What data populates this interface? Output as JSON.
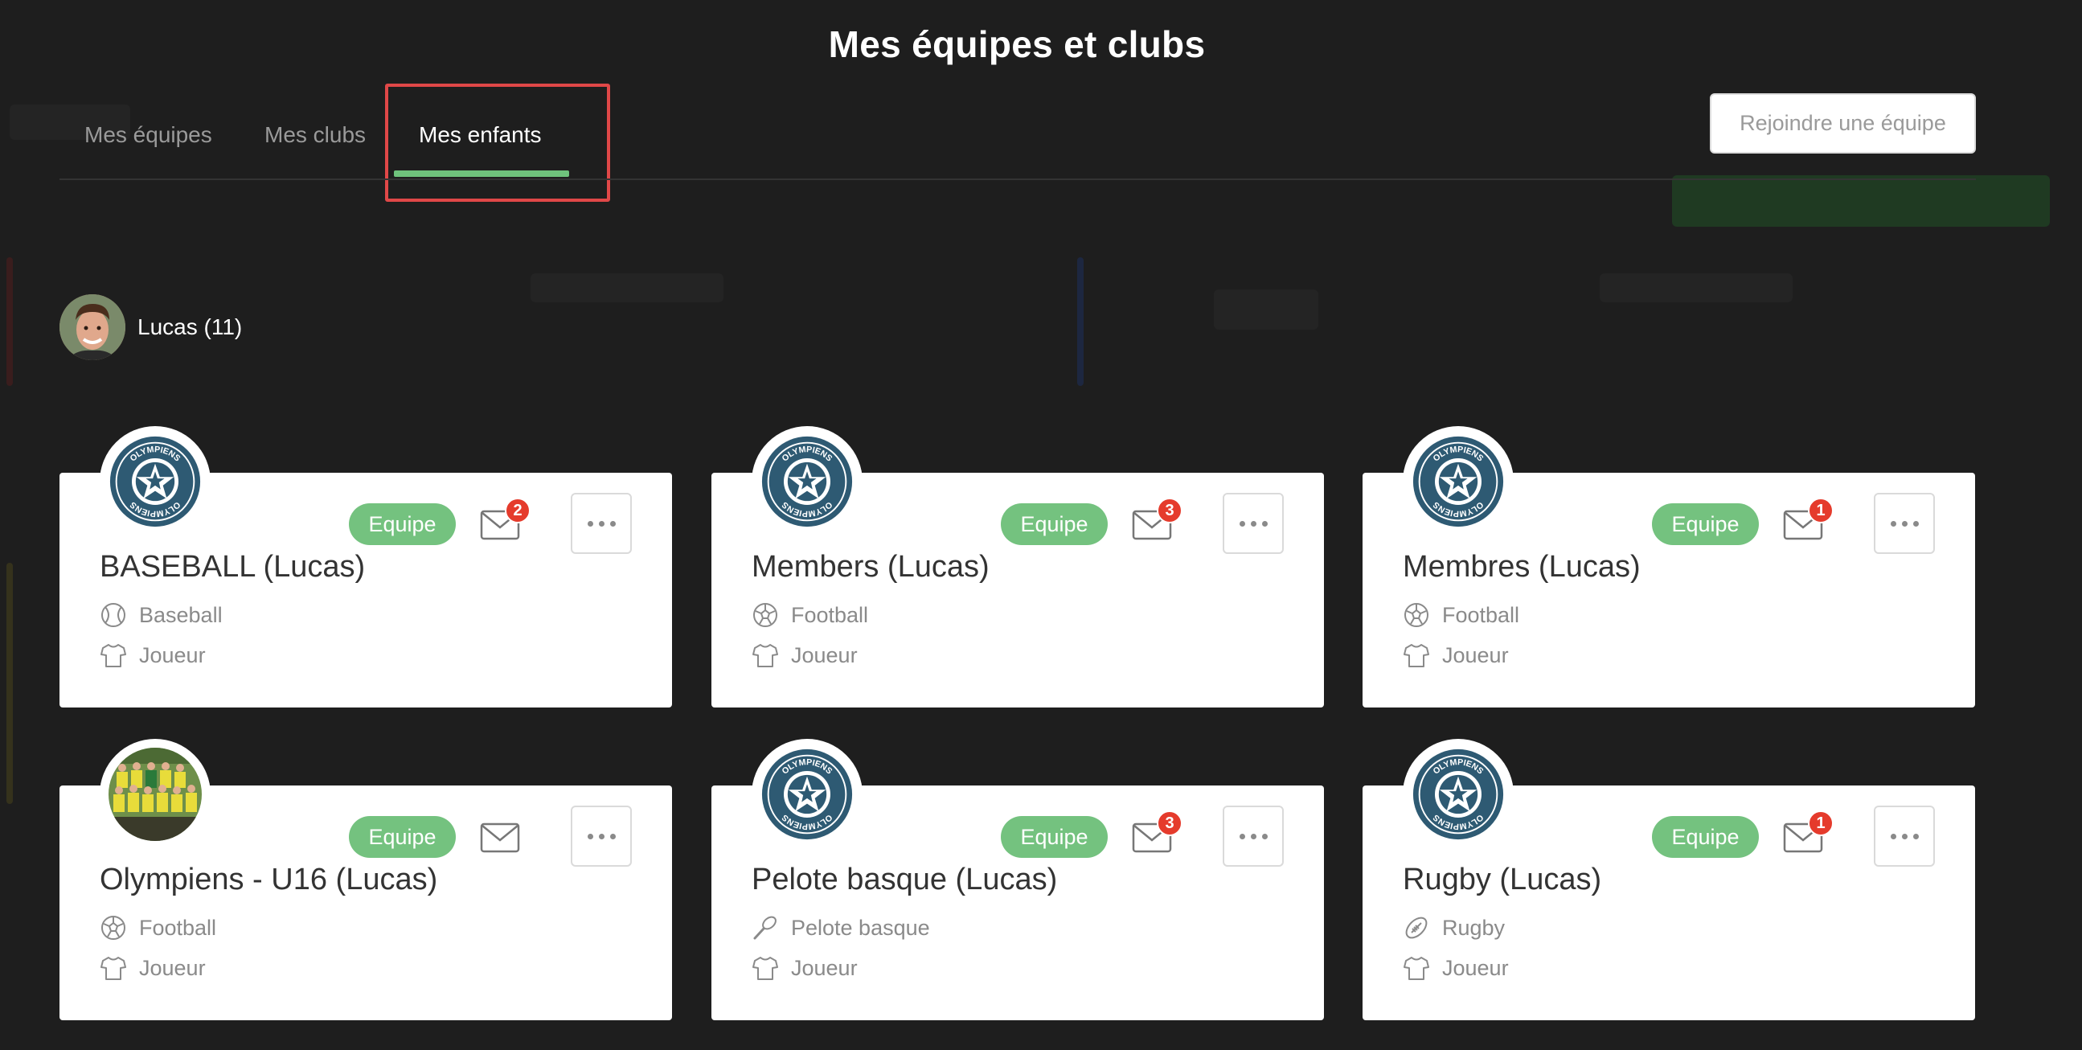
{
  "page_title": "Mes équipes et clubs",
  "tabs": [
    {
      "label": "Mes équipes",
      "active": false
    },
    {
      "label": "Mes clubs",
      "active": false
    },
    {
      "label": "Mes enfants",
      "active": true
    }
  ],
  "join_button": "Rejoindre une équipe",
  "child": {
    "name": "Lucas (11)",
    "avatar": "child-photo"
  },
  "colors": {
    "accent": "#6fc27c",
    "badge": "#74c27f",
    "notification": "#e53b2c",
    "highlight": "#e04848"
  },
  "teams": [
    {
      "name": "BASEBALL (Lucas)",
      "badge": "Equipe",
      "sport": "Baseball",
      "sport_icon": "baseball-icon",
      "role": "Joueur",
      "messages": "2",
      "logo": "olympiens-logo"
    },
    {
      "name": "Members (Lucas)",
      "badge": "Equipe",
      "sport": "Football",
      "sport_icon": "football-icon",
      "role": "Joueur",
      "messages": "3",
      "logo": "olympiens-logo"
    },
    {
      "name": "Membres (Lucas)",
      "badge": "Equipe",
      "sport": "Football",
      "sport_icon": "football-icon",
      "role": "Joueur",
      "messages": "1",
      "logo": "olympiens-logo"
    },
    {
      "name": "Olympiens - U16 (Lucas)",
      "badge": "Equipe",
      "sport": "Football",
      "sport_icon": "football-icon",
      "role": "Joueur",
      "messages": "",
      "logo": "team-photo"
    },
    {
      "name": "Pelote basque (Lucas)",
      "badge": "Equipe",
      "sport": "Pelote basque",
      "sport_icon": "pelota-icon",
      "role": "Joueur",
      "messages": "3",
      "logo": "olympiens-logo"
    },
    {
      "name": "Rugby (Lucas)",
      "badge": "Equipe",
      "sport": "Rugby",
      "sport_icon": "rugby-icon",
      "role": "Joueur",
      "messages": "1",
      "logo": "olympiens-logo"
    }
  ]
}
